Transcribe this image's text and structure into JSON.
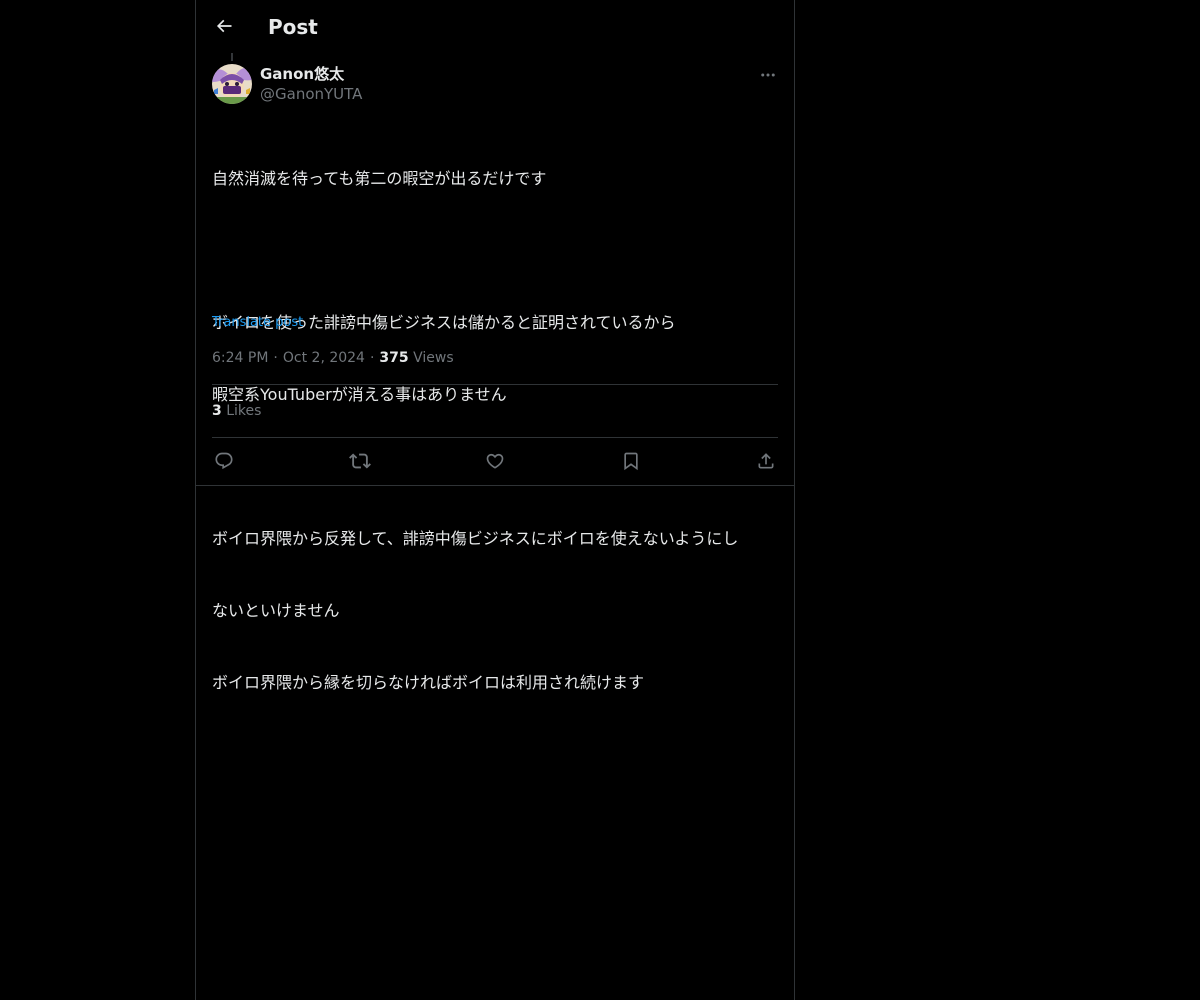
{
  "header": {
    "title": "Post",
    "back_icon": "arrow-left-icon"
  },
  "author": {
    "display_name": "Ganon悠太",
    "handle": "@GanonYUTA",
    "avatar_icon": "avatar-image"
  },
  "post": {
    "text_lines": [
      "自然消滅を待っても第二の暇空が出るだけです",
      "",
      "ボイロを使った誹謗中傷ビジネスは儲かると証明されているから",
      "暇空系YouTuberが消える事はありません",
      "",
      "ボイロ界隈から反発して、誹謗中傷ビジネスにボイロを使えないようにし",
      "ないといけません",
      "ボイロ界隈から縁を切らなければボイロは利用され続けます"
    ],
    "translate_label": "Translate post",
    "time": "6:24 PM",
    "date": "Oct 2, 2024",
    "views_count": "375",
    "views_label": "Views"
  },
  "engagement": {
    "likes_count": "3",
    "likes_label": "Likes"
  },
  "actions": [
    {
      "icon": "reply-icon"
    },
    {
      "icon": "repost-icon"
    },
    {
      "icon": "like-icon"
    },
    {
      "icon": "bookmark-icon"
    },
    {
      "icon": "share-icon"
    }
  ],
  "colors": {
    "background": "#000000",
    "text_primary": "#e7e9ea",
    "text_secondary": "#71767b",
    "link": "#1d9bf0",
    "border": "#2f3336"
  }
}
